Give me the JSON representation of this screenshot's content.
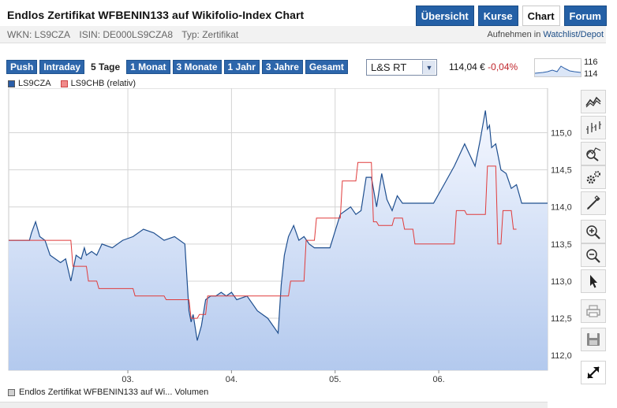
{
  "header": {
    "title": "Endlos Zertifikat WFBENIN133 auf Wikifolio-Index Chart",
    "tabs": [
      {
        "label": "Übersicht",
        "active": false
      },
      {
        "label": "Kurse",
        "active": false
      },
      {
        "label": "Chart",
        "active": true
      },
      {
        "label": "Forum",
        "active": false
      }
    ]
  },
  "identifiers": {
    "wkn": "WKN: LS9CZA",
    "isin": "ISIN: DE000LS9CZA8",
    "type": "Typ: Zertifikat"
  },
  "watchlist": {
    "prefix": "Aufnehmen in ",
    "link": "Watchlist/Depot"
  },
  "periods": [
    {
      "label": "Push",
      "active": false
    },
    {
      "label": "Intraday",
      "active": false
    },
    {
      "label": "5 Tage",
      "active": true
    },
    {
      "label": "1 Monat",
      "active": false
    },
    {
      "label": "3 Monate",
      "active": false
    },
    {
      "label": "1 Jahr",
      "active": false
    },
    {
      "label": "3 Jahre",
      "active": false
    },
    {
      "label": "Gesamt",
      "active": false
    }
  ],
  "exchange": {
    "selected": "L&S RT"
  },
  "quote": {
    "price": "114,04 €",
    "change": "-0,04%"
  },
  "mini_chart": {
    "high_label": "116",
    "low_label": "114"
  },
  "legend": [
    {
      "label": "LS9CZA",
      "color": "#2a5ea8"
    },
    {
      "label": "LS9CHB (relativ)",
      "color": "#e05c5c"
    }
  ],
  "bottom_legend": {
    "label": "Endlos Zertifikat WFBENIN133 auf Wi... Volumen"
  },
  "colors": {
    "accent": "#2460a6",
    "line_main": "#1f4f8f",
    "line_rel": "#e03b3b",
    "negative": "#c0262c",
    "fill_top": "#f4f8ff",
    "fill_bottom": "#b3c9ee"
  },
  "toolbar": [
    {
      "icon": "line-chart-icon",
      "label": "line chart"
    },
    {
      "icon": "ohlc-chart-icon",
      "label": "ohlc chart"
    },
    {
      "icon": "indicator-icon",
      "label": "indicators"
    },
    {
      "icon": "settings-icon",
      "label": "settings"
    },
    {
      "icon": "draw-line-icon",
      "label": "draw"
    },
    {
      "icon": "zoom-in-icon",
      "label": "zoom in"
    },
    {
      "icon": "zoom-out-icon",
      "label": "zoom out"
    },
    {
      "icon": "pointer-icon",
      "label": "pointer"
    },
    {
      "icon": "print-icon",
      "label": "print"
    },
    {
      "icon": "save-icon",
      "label": "save"
    },
    {
      "icon": "fullscreen-icon",
      "label": "fullscreen"
    }
  ],
  "chart_data": {
    "type": "area",
    "ylim": [
      111.8,
      115.6
    ],
    "yticks": [
      "112,0",
      "112,5",
      "113,0",
      "113,5",
      "114,0",
      "114,5",
      "115,0"
    ],
    "ytick_values": [
      112.0,
      112.5,
      113.0,
      113.5,
      114.0,
      114.5,
      115.0
    ],
    "xticks": [
      "03.",
      "04.",
      "05.",
      "06."
    ],
    "xtick_positions": [
      1.15,
      2.15,
      3.15,
      4.15
    ],
    "xlim": [
      0,
      5.2
    ],
    "grid": true,
    "series": [
      {
        "name": "LS9CZA",
        "x": [
          0,
          0.2,
          0.22,
          0.26,
          0.3,
          0.35,
          0.4,
          0.5,
          0.55,
          0.6,
          0.65,
          0.7,
          0.73,
          0.75,
          0.8,
          0.85,
          0.9,
          1.0,
          1.1,
          1.2,
          1.3,
          1.4,
          1.5,
          1.6,
          1.7,
          1.74,
          1.76,
          1.78,
          1.82,
          1.86,
          1.9,
          1.95,
          2.0,
          2.05,
          2.1,
          2.15,
          2.2,
          2.3,
          2.4,
          2.5,
          2.6,
          2.63,
          2.66,
          2.7,
          2.75,
          2.8,
          2.85,
          2.9,
          2.95,
          3.0,
          3.05,
          3.1,
          3.2,
          3.25,
          3.3,
          3.35,
          3.4,
          3.45,
          3.5,
          3.55,
          3.6,
          3.65,
          3.7,
          3.75,
          3.8,
          3.85,
          3.9,
          3.95,
          4.0,
          4.1,
          4.2,
          4.3,
          4.4,
          4.5,
          4.55,
          4.6,
          4.62,
          4.64,
          4.66,
          4.7,
          4.75,
          4.8,
          4.85,
          4.9,
          4.95,
          5.2
        ],
        "values": [
          113.55,
          113.55,
          113.65,
          113.8,
          113.6,
          113.55,
          113.35,
          113.25,
          113.3,
          113.0,
          113.35,
          113.3,
          113.45,
          113.35,
          113.4,
          113.35,
          113.5,
          113.45,
          113.55,
          113.6,
          113.7,
          113.65,
          113.55,
          113.6,
          113.5,
          112.6,
          112.45,
          112.55,
          112.2,
          112.4,
          112.75,
          112.8,
          112.8,
          112.85,
          112.8,
          112.85,
          112.75,
          112.8,
          112.6,
          112.5,
          112.3,
          112.95,
          113.35,
          113.6,
          113.75,
          113.55,
          113.6,
          113.5,
          113.45,
          113.45,
          113.45,
          113.45,
          113.9,
          113.95,
          114.0,
          113.9,
          113.95,
          114.4,
          114.4,
          114.0,
          114.45,
          114.1,
          113.95,
          114.15,
          114.05,
          114.05,
          114.05,
          114.05,
          114.05,
          114.05,
          114.3,
          114.55,
          114.85,
          114.55,
          114.9,
          115.3,
          115.05,
          115.1,
          114.8,
          114.85,
          114.5,
          114.45,
          114.25,
          114.3,
          114.05,
          114.05
        ]
      },
      {
        "name": "LS9CHB (relativ)",
        "x": [
          0,
          0.6,
          0.62,
          0.75,
          0.77,
          0.85,
          0.87,
          1.2,
          1.22,
          1.5,
          1.52,
          1.74,
          1.76,
          1.82,
          1.84,
          1.9,
          1.92,
          2.6,
          2.62,
          2.7,
          2.72,
          2.85,
          2.87,
          2.95,
          2.97,
          3.2,
          3.22,
          3.35,
          3.37,
          3.5,
          3.52,
          3.55,
          3.57,
          3.7,
          3.72,
          3.8,
          3.82,
          3.9,
          3.92,
          4.3,
          4.32,
          4.4,
          4.42,
          4.6,
          4.62,
          4.7,
          4.72,
          4.75,
          4.77,
          4.85,
          4.87,
          4.9
        ],
        "values": [
          113.55,
          113.55,
          113.2,
          113.2,
          113.0,
          113.0,
          112.9,
          112.9,
          112.8,
          112.8,
          112.75,
          112.75,
          112.5,
          112.5,
          112.55,
          112.55,
          112.8,
          112.8,
          112.8,
          112.8,
          113.0,
          113.0,
          113.55,
          113.55,
          113.85,
          113.85,
          114.35,
          114.35,
          114.6,
          114.6,
          113.8,
          113.8,
          113.75,
          113.75,
          113.85,
          113.85,
          113.7,
          113.7,
          113.5,
          113.5,
          113.95,
          113.95,
          113.9,
          113.9,
          114.55,
          114.55,
          113.5,
          113.5,
          113.95,
          113.95,
          113.7,
          113.7
        ]
      }
    ]
  }
}
